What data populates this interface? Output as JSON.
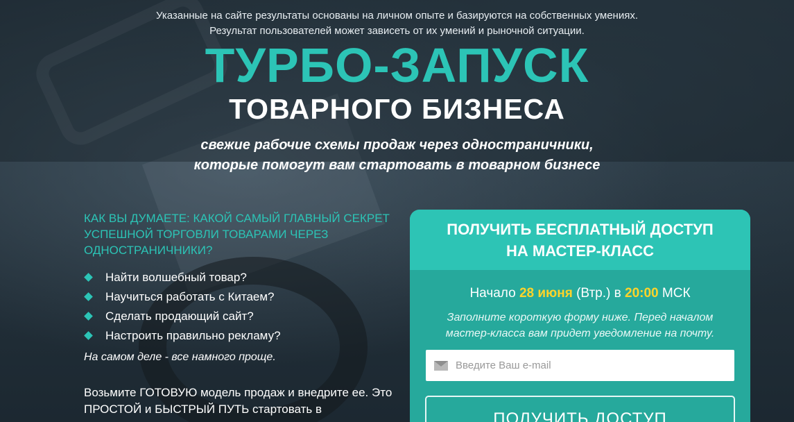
{
  "disclaimer": {
    "line1": "Указанные на сайте результаты основаны на личном опыте и базируются на собственных умениях.",
    "line2": "Результат пользователей может зависеть от их умений и рыночной ситуации."
  },
  "hero": {
    "title_main": "ТУРБО-ЗАПУСК",
    "title_sub": "ТОВАРНОГО БИЗНЕСА",
    "subtitle_line1": "свежие рабочие схемы продаж через одностраничники,",
    "subtitle_line2": "которые помогут вам стартовать в товарном бизнесе"
  },
  "left": {
    "question": "Как вы думаете: какой самый главный секрет успешной торговли товарами через одностраничники?",
    "bullets": [
      "Найти волшебный товар?",
      "Научиться работать с Китаем?",
      "Сделать продающий сайт?",
      "Настроить правильно рекламу?"
    ],
    "note": "На самом деле - все намного проще.",
    "cta_text": "Возьмите ГОТОВУЮ модель продаж и внедрите ее. Это ПРОСТОЙ и БЫСТРЫЙ ПУТЬ стартовать в"
  },
  "form": {
    "header_line1": "ПОЛУЧИТЬ БЕСПЛАТНЫЙ ДОСТУП",
    "header_line2": "НА МАСТЕР-КЛАСС",
    "start_prefix": "Начало",
    "start_date": "28 июня",
    "start_weekday": "(Втр.) в",
    "start_time": "20:00",
    "start_tz": "МСК",
    "note_line1": "Заполните короткую форму ниже. Перед началом",
    "note_line2": "мастер-класса вам придет уведомление на почту.",
    "email_placeholder": "Введите Ваш e-mail",
    "email_icon": "envelope-icon",
    "submit_label": "ПОЛУЧИТЬ ДОСТУП"
  },
  "colors": {
    "accent": "#2cc4b6",
    "highlight": "#ffd42a",
    "background": "#1e2a33"
  }
}
